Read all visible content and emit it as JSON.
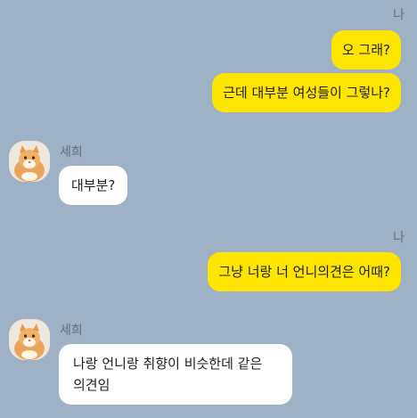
{
  "chat": {
    "my_name": "나",
    "friend_name": "세희",
    "messages": [
      {
        "from": "me",
        "text": "오 그래?"
      },
      {
        "from": "me",
        "text": "근데 대부분 여성들이 그렇나?"
      },
      {
        "from": "friend",
        "text": "대부분?"
      },
      {
        "from": "me",
        "text": "그냥 너랑 너 언니의견은 어때?"
      },
      {
        "from": "friend",
        "text": "나랑 언니랑 취향이 비슷한데 같은 의견임"
      }
    ]
  },
  "colors": {
    "background": "#9fb1c5",
    "my_bubble": "#fee500",
    "friend_bubble": "#ffffff"
  },
  "icons": {
    "avatar": "cat-photo-avatar"
  }
}
